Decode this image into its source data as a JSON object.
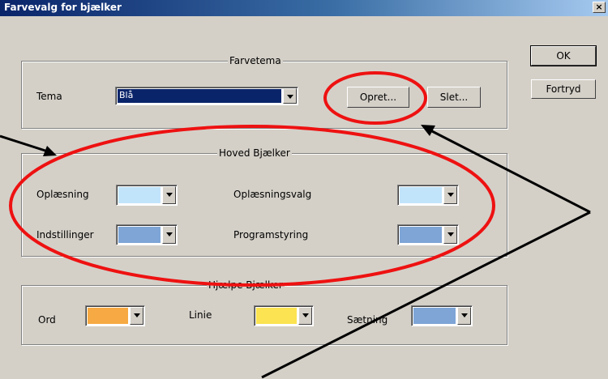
{
  "window": {
    "title": "Farvevalg for bjælker",
    "close_label": "×"
  },
  "buttons": {
    "ok": "OK",
    "cancel": "Fortryd",
    "create": "Opret...",
    "delete": "Slet..."
  },
  "farvetema": {
    "legend": "Farvetema",
    "tema_label": "Tema",
    "tema_value": "Blå"
  },
  "hoved": {
    "legend": "Hoved Bjælker",
    "oplaesning": {
      "label": "Oplæsning",
      "color": "#c2e4fb"
    },
    "oplaesningsvalg": {
      "label": "Oplæsningsvalg",
      "color": "#c2e4fb"
    },
    "indstillinger": {
      "label": "Indstillinger",
      "color": "#7ea5d6"
    },
    "programstyring": {
      "label": "Programstyring",
      "color": "#7ea5d6"
    }
  },
  "hjaelpe": {
    "legend": "Hjælpe Bjælker",
    "ord": {
      "label": "Ord",
      "color": "#f7aa43"
    },
    "linie": {
      "label": "Linie",
      "color": "#fbe351"
    },
    "saetning": {
      "label": "Sætning",
      "color": "#7ea5d6"
    }
  },
  "annotation_color": "#ee1111"
}
